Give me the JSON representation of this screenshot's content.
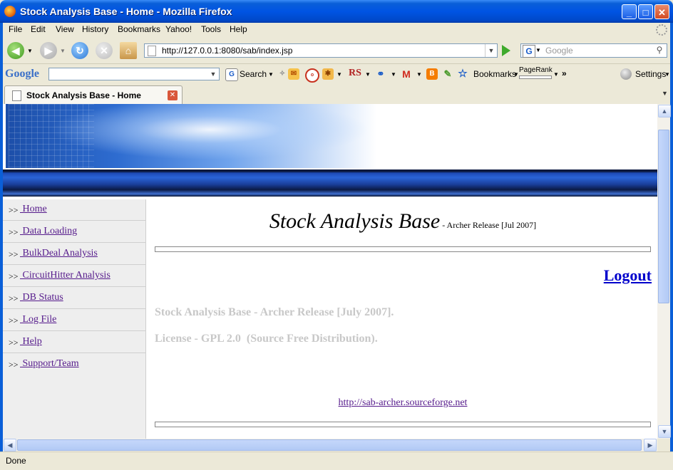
{
  "window": {
    "title": "Stock Analysis Base - Home - Mozilla Firefox",
    "minimize_glyph": "_",
    "maximize_glyph": "□",
    "close_glyph": "✕"
  },
  "menu": [
    "File",
    "Edit",
    "View",
    "History",
    "Bookmarks",
    "Yahoo!",
    "Tools",
    "Help"
  ],
  "navbar": {
    "url": "http://127.0.0.1:8080/sab/index.jsp",
    "search_engine_letter": "G",
    "search_placeholder": "Google"
  },
  "google_toolbar": {
    "logo": "Google",
    "search_label": "Search",
    "rs_label": "RS",
    "bookmarks_label": "Bookmarks",
    "pagerank_label": "PageRank",
    "more_label": "»",
    "settings_label": "Settings"
  },
  "tab": {
    "label": "Stock Analysis Base - Home"
  },
  "page": {
    "title_big": "Stock Analysis Base",
    "title_small": " - Archer Release  [Jul 2007]",
    "logout_label": "Logout",
    "release_line": "Stock Analysis Base - Archer Release [July 2007].",
    "license_line": "License - GPL 2.0  (Source Free Distribution).",
    "project_link": "http://sab-archer.sourceforge.net",
    "nav_arrow": ">>",
    "nav_items": [
      " Home",
      " Data Loading",
      " BulkDeal Analysis",
      " CircuitHitter Analysis",
      " DB Status",
      " Log File",
      " Help",
      " Support/Team"
    ]
  },
  "status": {
    "text": "Done"
  },
  "colors": {
    "visited_link": "#551a8b",
    "logout_link": "#0000cc",
    "faded_text": "#c8c8c8",
    "xp_blue": "#0054e3"
  }
}
